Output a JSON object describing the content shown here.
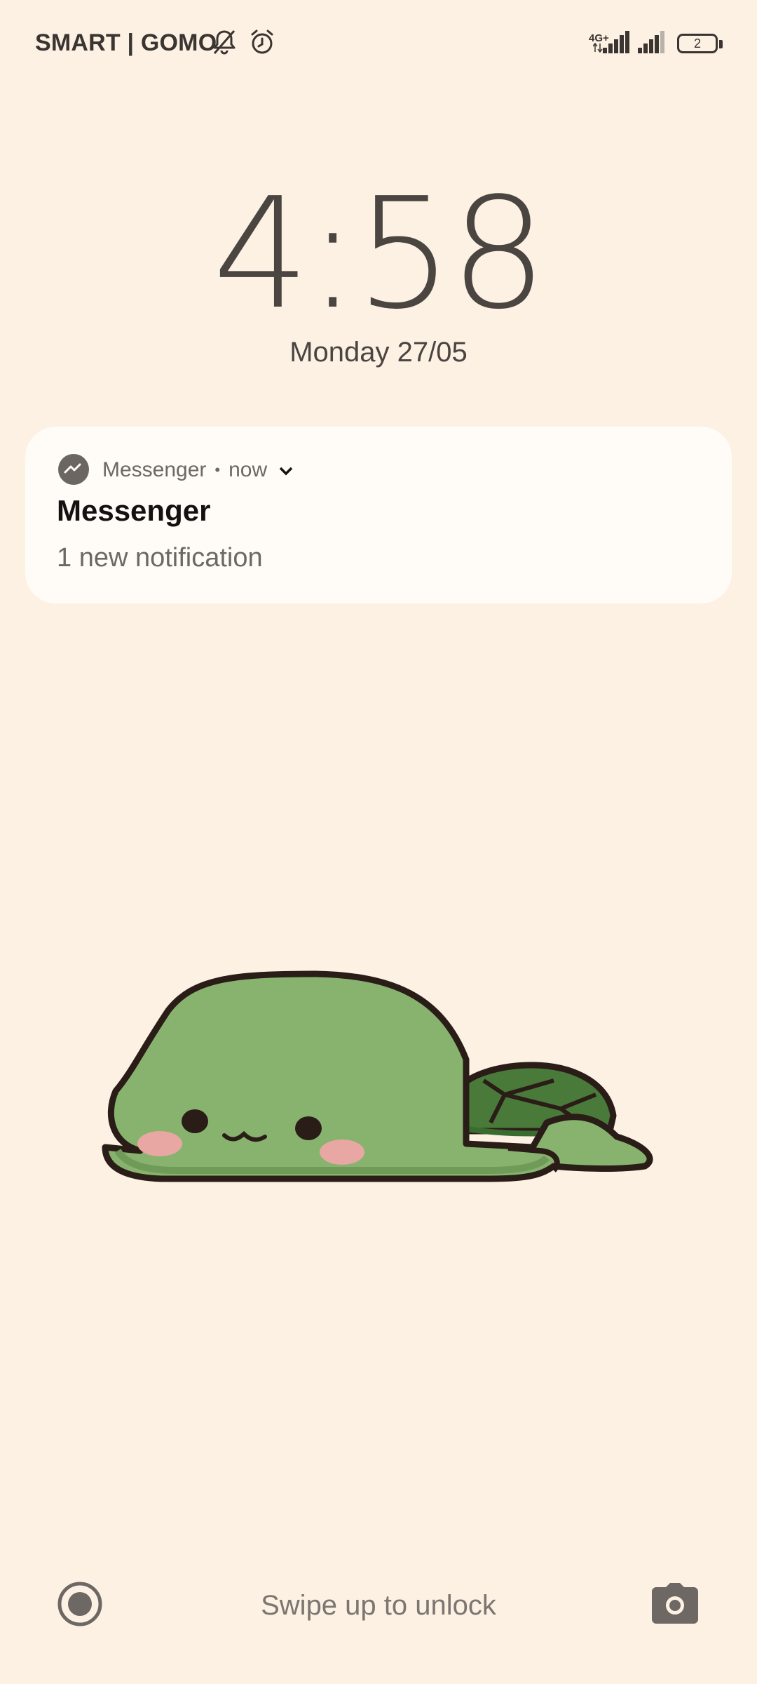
{
  "status_bar": {
    "carrier": "SMART | GOMO",
    "network_type": "4G+",
    "battery_level": "2",
    "icons": [
      "notifications-off-icon",
      "alarm-icon",
      "signal-icon",
      "signal-icon",
      "battery-icon"
    ]
  },
  "lock_screen": {
    "time": "4:58",
    "date": "Monday 27/05"
  },
  "notification": {
    "app_icon": "messenger-icon",
    "app_name": "Messenger",
    "separator": "•",
    "time": "now",
    "title": "Messenger",
    "body": "1 new notification"
  },
  "bottom_bar": {
    "left_shortcut_icon": "record-icon",
    "unlock_hint": "Swipe up to unlock",
    "right_shortcut_icon": "camera-icon"
  },
  "colors": {
    "background": "#fdf1e4",
    "card": "#fffcf8",
    "turtle_body": "#88b36e",
    "turtle_shell": "#4a7a3a",
    "blush": "#e8a7a3"
  }
}
